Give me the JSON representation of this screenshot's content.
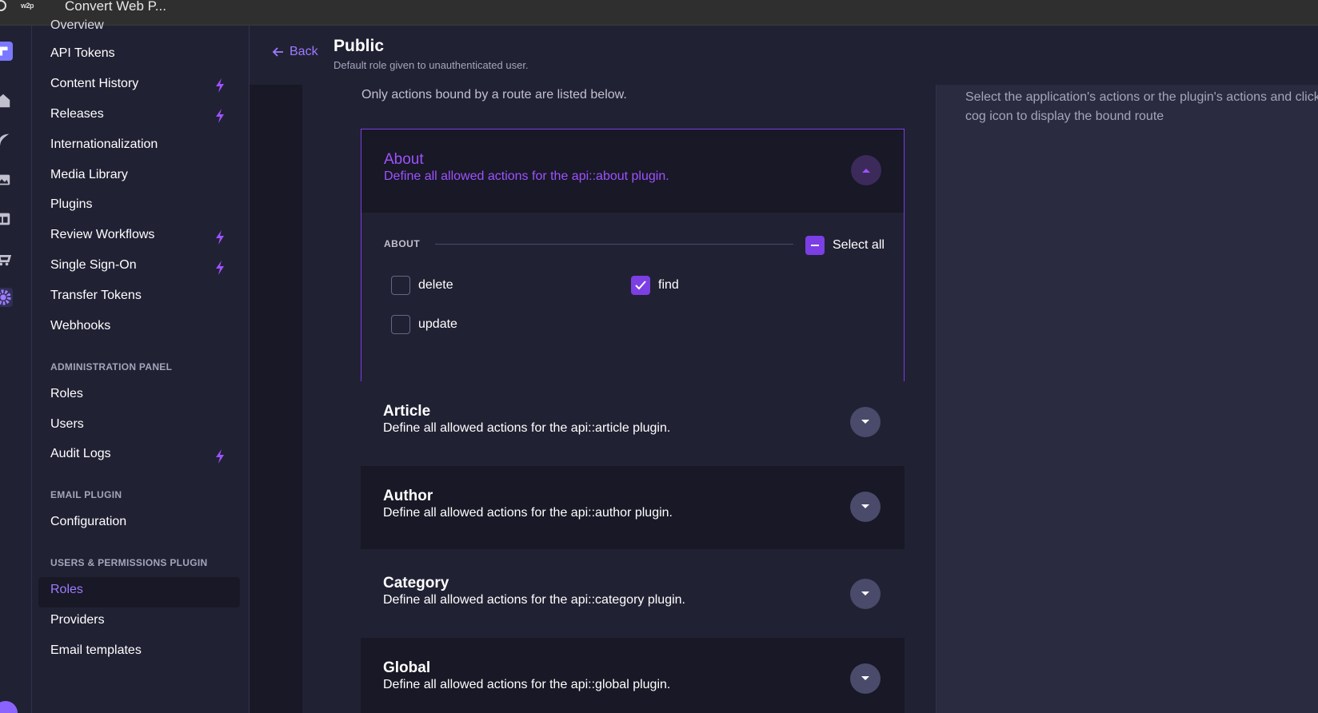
{
  "os": {
    "app_logo": "w2p",
    "app_title": "Convert Web P..."
  },
  "colors": {
    "accent": "#7b3fe4",
    "accent_text": "#9e52ff",
    "panel": "#212134",
    "background": "#181826"
  },
  "subnav": {
    "clipped_item": "Overview",
    "settings_items": [
      {
        "label": "API Tokens",
        "bolt": false
      },
      {
        "label": "Content History",
        "bolt": true
      },
      {
        "label": "Releases",
        "bolt": true
      },
      {
        "label": "Internationalization",
        "bolt": false
      },
      {
        "label": "Media Library",
        "bolt": false
      },
      {
        "label": "Plugins",
        "bolt": false
      },
      {
        "label": "Review Workflows",
        "bolt": true
      },
      {
        "label": "Single Sign-On",
        "bolt": true
      },
      {
        "label": "Transfer Tokens",
        "bolt": false
      },
      {
        "label": "Webhooks",
        "bolt": false
      }
    ],
    "admin_title": "ADMINISTRATION PANEL",
    "admin_items": [
      {
        "label": "Roles",
        "bolt": false
      },
      {
        "label": "Users",
        "bolt": false
      },
      {
        "label": "Audit Logs",
        "bolt": true
      }
    ],
    "email_title": "EMAIL PLUGIN",
    "email_items": [
      {
        "label": "Configuration"
      }
    ],
    "up_title": "USERS & PERMISSIONS PLUGIN",
    "up_items": [
      {
        "label": "Roles",
        "active": true
      },
      {
        "label": "Providers",
        "active": false
      },
      {
        "label": "Email templates",
        "active": false
      }
    ]
  },
  "header": {
    "back_label": "Back",
    "title": "Public",
    "subtitle": "Default role given to unauthenticated user."
  },
  "permissions": {
    "intro": "Only actions bound by a route are listed below.",
    "open_section": {
      "title": "About",
      "description": "Define all allowed actions for the api::about plugin.",
      "group_label": "ABOUT",
      "select_all_label": "Select all",
      "select_all_state": "indeterminate",
      "actions": [
        {
          "label": "delete",
          "checked": false
        },
        {
          "label": "find",
          "checked": true
        },
        {
          "label": "update",
          "checked": false
        }
      ]
    },
    "sections": [
      {
        "title": "Article",
        "description": "Define all allowed actions for the api::article plugin."
      },
      {
        "title": "Author",
        "description": "Define all allowed actions for the api::author plugin."
      },
      {
        "title": "Category",
        "description": "Define all allowed actions for the api::category plugin."
      },
      {
        "title": "Global",
        "description": "Define all allowed actions for the api::global plugin."
      }
    ]
  },
  "right_panel": {
    "help_text": "Select the application's actions or the plugin's actions and click on the cog icon to display the bound route"
  },
  "icons": {
    "rail": [
      "brand-logo-icon",
      "home-icon",
      "feather-icon",
      "media-icon",
      "layout-icon",
      "cart-icon",
      "cog-icon"
    ],
    "bolt": "lightning-bolt-icon",
    "back": "arrow-left-icon",
    "toggle_open": "chevron-up-icon",
    "toggle_closed": "chevron-down-icon"
  }
}
